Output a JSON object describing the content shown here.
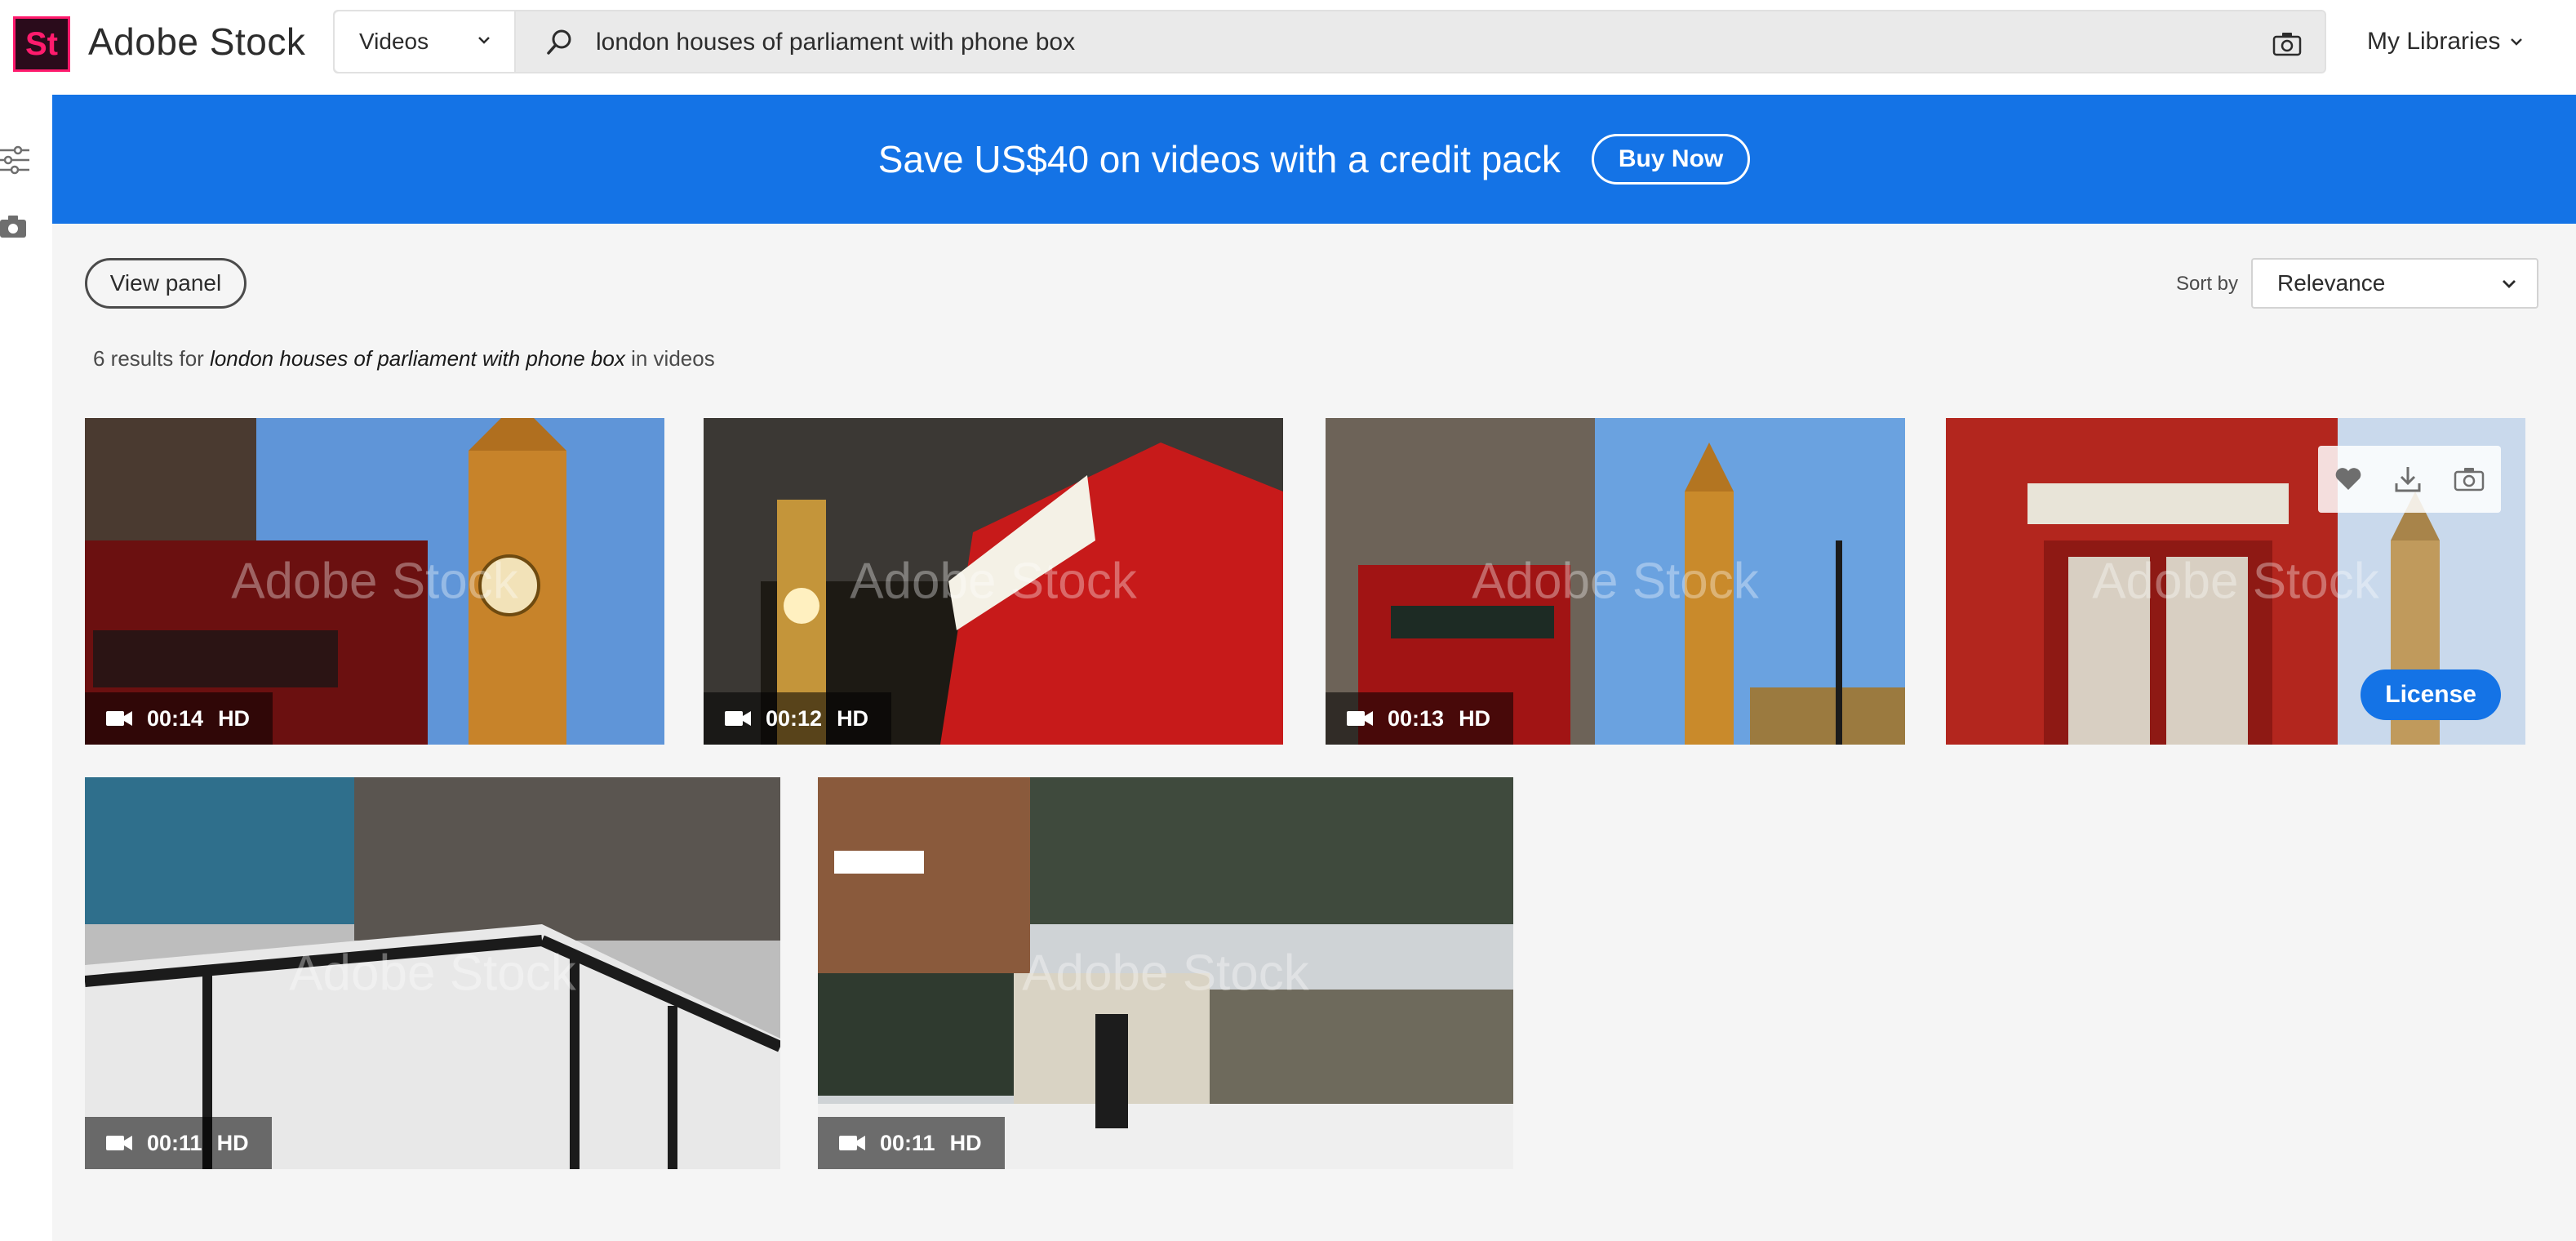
{
  "brand": {
    "logo": "St",
    "name": "Adobe Stock"
  },
  "search": {
    "type_selected": "Videos",
    "query": "london houses of parliament with phone box",
    "icons": [
      "search-icon",
      "camera-icon"
    ]
  },
  "header": {
    "my_libraries": "My Libraries"
  },
  "left_rail": {
    "icons": [
      "filters-icon",
      "camera-icon"
    ]
  },
  "promo": {
    "text": "Save US$40 on videos with a credit pack",
    "button": "Buy Now",
    "color": "#1473e6"
  },
  "controls": {
    "view_panel": "View panel",
    "sort_label": "Sort by",
    "sort_value": "Relevance"
  },
  "results": {
    "count_text": "6 results for",
    "query": "london houses of parliament with phone box",
    "suffix": "in videos"
  },
  "watermark": "Adobe Stock",
  "videos": [
    {
      "duration": "00:14",
      "quality": "HD",
      "subject": "Big Ben with red phone box at left"
    },
    {
      "duration": "00:12",
      "quality": "HD",
      "subject": "Red telephone box at night, Big Ben behind"
    },
    {
      "duration": "00:13",
      "quality": "HD",
      "subject": "Telephone box and Big Ben under blue sky"
    },
    {
      "duration": "",
      "quality": "",
      "subject": "Red telephone box with Big Ben",
      "hover": true,
      "actions": [
        "heart-icon",
        "download-icon",
        "camera-icon"
      ],
      "license": "License"
    },
    {
      "duration": "00:11",
      "quality": "HD",
      "subject": "Snow on black iron railing"
    },
    {
      "duration": "00:11",
      "quality": "HD",
      "subject": "Snowy London street, Wood Vale sign"
    }
  ],
  "accent_color": "#1473e6",
  "logo_color": "#ff1b6d"
}
